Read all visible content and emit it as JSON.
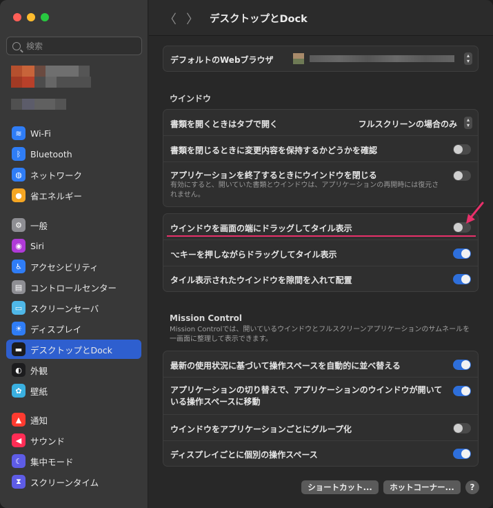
{
  "window": {
    "title": "デスクトップとDock"
  },
  "search": {
    "placeholder": "検索"
  },
  "sidebar": {
    "items": [
      {
        "label": "Wi-Fi",
        "icon": "wifi-icon",
        "color": "#2f7df6"
      },
      {
        "label": "Bluetooth",
        "icon": "bluetooth-icon",
        "color": "#2f7df6"
      },
      {
        "label": "ネットワーク",
        "icon": "globe-icon",
        "color": "#2f7df6"
      },
      {
        "label": "省エネルギー",
        "icon": "lightbulb-icon",
        "color": "#f5a623"
      },
      {
        "label": "一般",
        "icon": "gear-icon",
        "color": "#8e8e93"
      },
      {
        "label": "Siri",
        "icon": "siri-icon",
        "color": "#b03ad8"
      },
      {
        "label": "アクセシビリティ",
        "icon": "accessibility-icon",
        "color": "#2f7df6"
      },
      {
        "label": "コントロールセンター",
        "icon": "control-center-icon",
        "color": "#8e8e93"
      },
      {
        "label": "スクリーンセーバ",
        "icon": "screensaver-icon",
        "color": "#4fb8e8"
      },
      {
        "label": "ディスプレイ",
        "icon": "sun-icon",
        "color": "#2f7df6"
      },
      {
        "label": "デスクトップとDock",
        "icon": "dock-icon",
        "color": "#1c1c1e"
      },
      {
        "label": "外観",
        "icon": "appearance-icon",
        "color": "#1c1c1e"
      },
      {
        "label": "壁紙",
        "icon": "flower-icon",
        "color": "#3ab0e0"
      },
      {
        "label": "通知",
        "icon": "bell-icon",
        "color": "#ff3b30"
      },
      {
        "label": "サウンド",
        "icon": "speaker-icon",
        "color": "#ff2d55"
      },
      {
        "label": "集中モード",
        "icon": "moon-icon",
        "color": "#5e5ce6"
      },
      {
        "label": "スクリーンタイム",
        "icon": "hourglass-icon",
        "color": "#5e5ce6"
      }
    ],
    "active": "デスクトップとDock"
  },
  "default_browser": {
    "label": "デフォルトのWebブラウザ"
  },
  "windows_section": {
    "title": "ウインドウ",
    "rows": [
      {
        "label": "書類を開くときはタブで開く",
        "value": "フルスクリーンの場合のみ"
      },
      {
        "label": "書類を閉じるときに変更内容を保持するかどうかを確認",
        "on": false
      },
      {
        "label": "アプリケーションを終了するときにウインドウを閉じる",
        "sub": "有効にすると、開いていた書類とウインドウは、アプリケーションの再開時には復元されません。",
        "on": false
      }
    ]
  },
  "tiling_section": {
    "rows": [
      {
        "label": "ウインドウを画面の端にドラッグしてタイル表示",
        "on": false
      },
      {
        "label": "⌥キーを押しながらドラッグしてタイル表示",
        "on": true
      },
      {
        "label": "タイル表示されたウインドウを隙間を入れて配置",
        "on": true
      }
    ]
  },
  "mission_control": {
    "title": "Mission Control",
    "desc": "Mission Controlでは、開いているウインドウとフルスクリーンアプリケーションのサムネールを一画面に整理して表示できます。",
    "rows": [
      {
        "label": "最新の使用状況に基づいて操作スペースを自動的に並べ替える",
        "on": true
      },
      {
        "label": "アプリケーションの切り替えで、アプリケーションのウインドウが開いている操作スペースに移動",
        "on": true
      },
      {
        "label": "ウインドウをアプリケーションごとにグループ化",
        "on": false
      },
      {
        "label": "ディスプレイごとに個別の操作スペース",
        "on": true
      }
    ]
  },
  "buttons": {
    "shortcuts": "ショートカット...",
    "hot_corners": "ホットコーナー...",
    "help": "?"
  },
  "accent_color": "#2e6fdb",
  "annotation_color": "#e8306a"
}
